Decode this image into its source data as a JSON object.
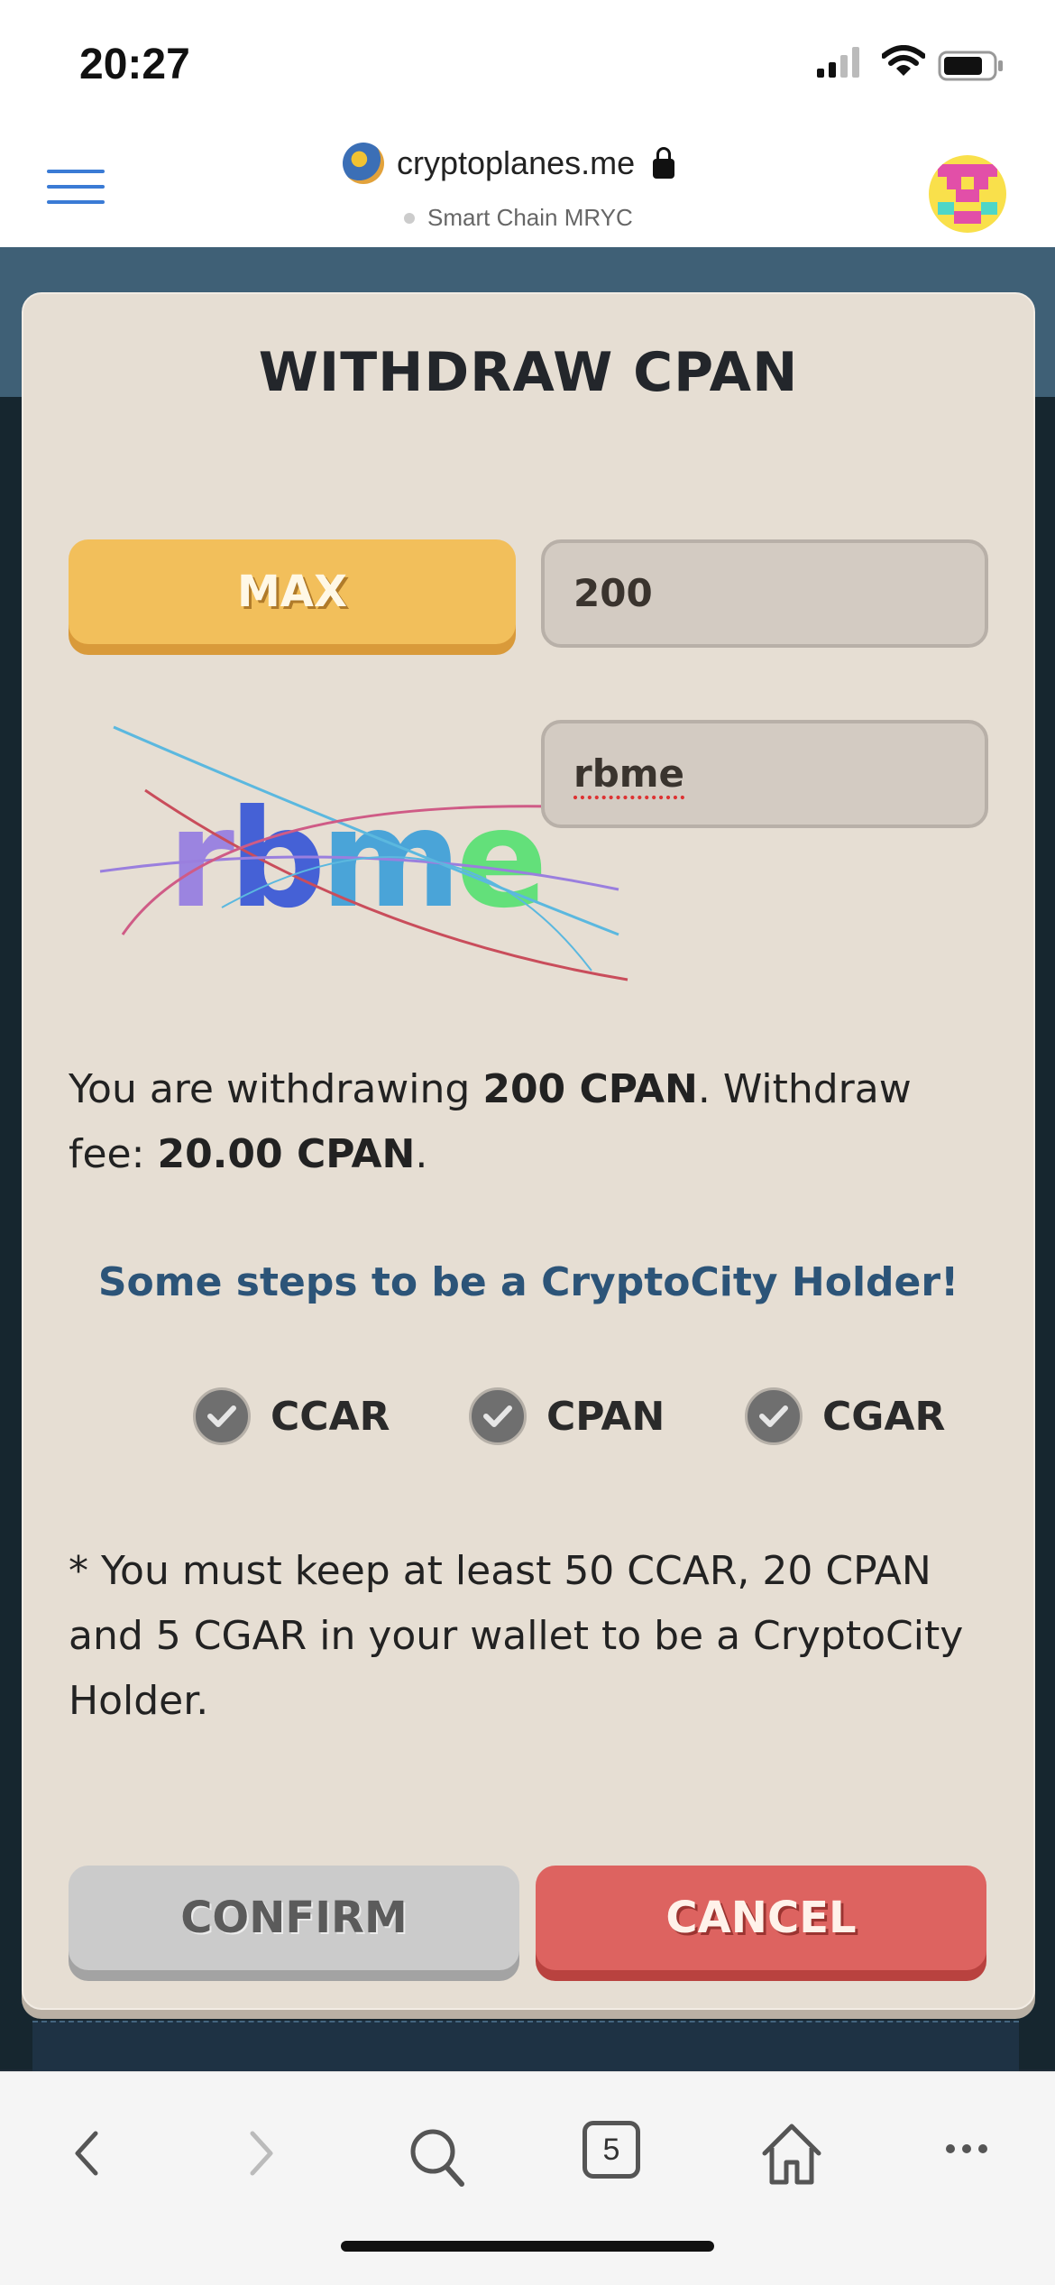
{
  "status": {
    "time": "20:27"
  },
  "browser": {
    "url": "cryptoplanes.me",
    "subtitle": "Smart Chain MRYC",
    "tab_count": "5"
  },
  "modal": {
    "title": "WITHDRAW CPAN",
    "max_label": "MAX",
    "amount_value": "200",
    "captcha_text": "rbme",
    "captcha_input_value": "rbme",
    "info": {
      "prefix": "You are withdrawing ",
      "amount": "200 CPAN",
      "middle": ". Withdraw fee: ",
      "fee": "20.00 CPAN",
      "suffix": "."
    },
    "steps_heading": "Some steps to be a CryptoCity Holder!",
    "checks": [
      "CCAR",
      "CPAN",
      "CGAR"
    ],
    "note": "* You must keep at least 50 CCAR, 20 CPAN and 5 CGAR in your wallet to be a CryptoCity Holder.",
    "confirm_label": "CONFIRM",
    "cancel_label": "CANCEL"
  },
  "colors": {
    "max": "#f2bf5b",
    "cancel": "#dd6360",
    "confirm": "#cbcbcb",
    "link": "#2c5478",
    "modal_bg": "#e6ded3"
  },
  "icons": [
    "menu-icon",
    "lock-icon",
    "signal-icon",
    "wifi-icon",
    "battery-icon",
    "check-icon",
    "back-icon",
    "forward-icon",
    "search-icon",
    "home-icon",
    "more-icon"
  ]
}
